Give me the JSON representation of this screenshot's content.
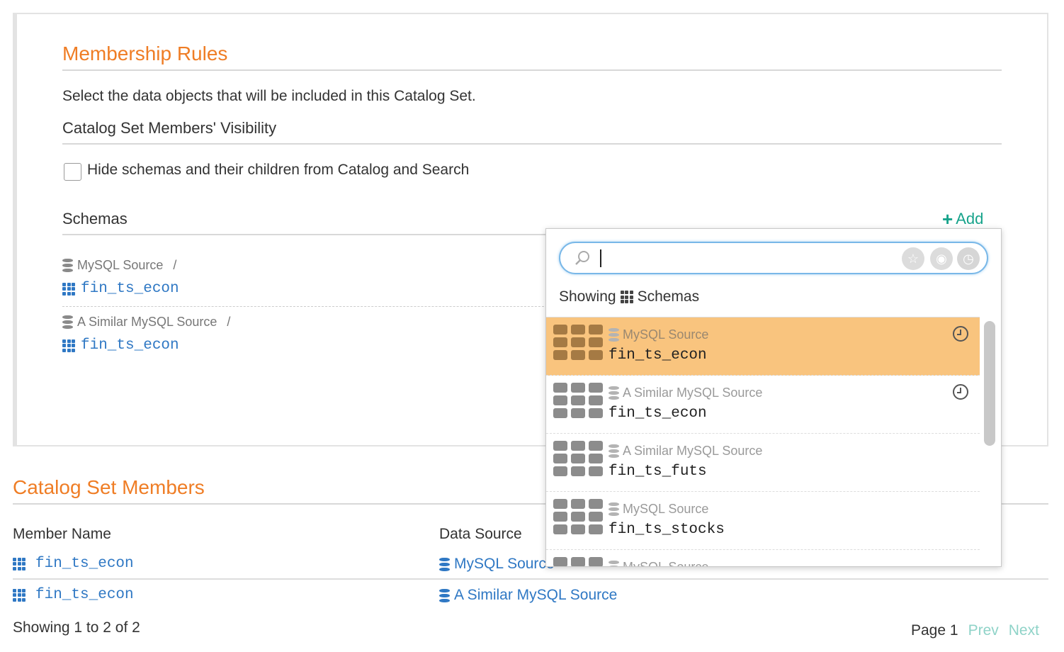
{
  "membership": {
    "title": "Membership Rules",
    "description": "Select the data objects that will be included in this Catalog Set.",
    "visibility_heading": "Catalog Set Members' Visibility",
    "hide_checkbox_label": "Hide schemas and their children from Catalog and Search",
    "hide_checked": false,
    "schemas_heading": "Schemas",
    "add_label": "Add",
    "schemas": [
      {
        "source": "MySQL Source",
        "separator": "/",
        "name": "fin_ts_econ"
      },
      {
        "source": "A Similar MySQL Source",
        "separator": "/",
        "name": "fin_ts_econ"
      }
    ]
  },
  "members": {
    "title": "Catalog Set Members",
    "columns": [
      "Member Name",
      "Data Source"
    ],
    "rows": [
      {
        "name": "fin_ts_econ",
        "source": "MySQL Source"
      },
      {
        "name": "fin_ts_econ",
        "source": "A Similar MySQL Source"
      }
    ],
    "showing": "Showing 1 to 2 of 2",
    "page": "Page 1",
    "prev": "Prev",
    "next": "Next"
  },
  "dropdown": {
    "search_value": "",
    "showing_prefix": "Showing",
    "showing_type": "Schemas",
    "items": [
      {
        "source": "MySQL Source",
        "name": "fin_ts_econ",
        "recent": true,
        "selected": true
      },
      {
        "source": "A Similar MySQL Source",
        "name": "fin_ts_econ",
        "recent": true,
        "selected": false
      },
      {
        "source": "A Similar MySQL Source",
        "name": "fin_ts_futs",
        "recent": false,
        "selected": false
      },
      {
        "source": "MySQL Source",
        "name": "fin_ts_stocks",
        "recent": false,
        "selected": false
      },
      {
        "source": "MySQL Source",
        "name": "",
        "recent": false,
        "selected": false
      }
    ]
  },
  "colors": {
    "accent_orange": "#ef7d25",
    "link_blue": "#2f78c4",
    "add_green": "#17a38b",
    "selected_row": "#f9c47e"
  }
}
